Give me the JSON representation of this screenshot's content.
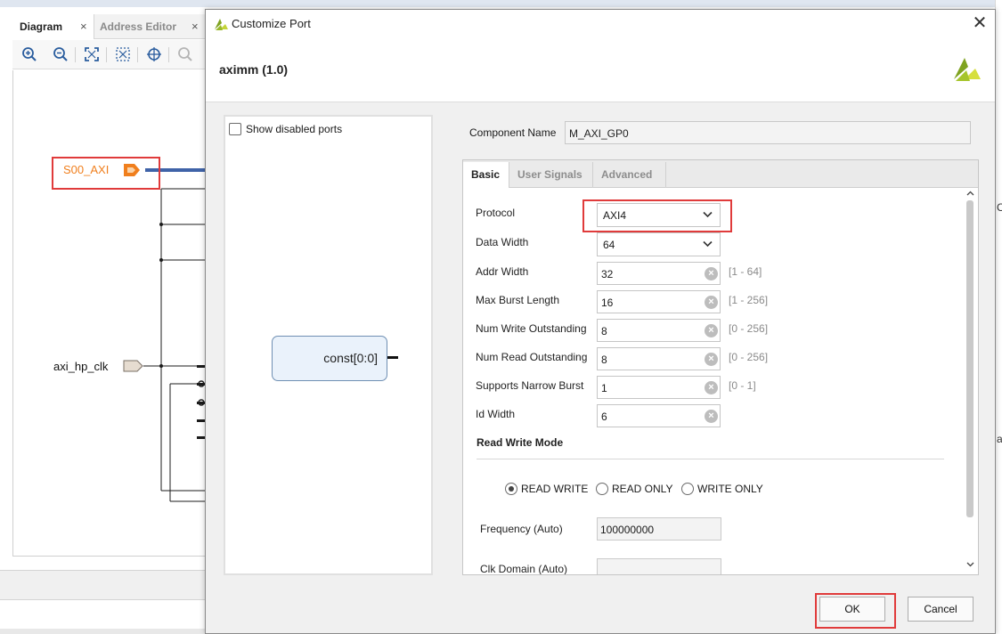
{
  "background": {
    "tabs": [
      {
        "label": "Diagram"
      },
      {
        "label": "Address Editor"
      }
    ],
    "tab_close_glyph": "×",
    "toolbar_icons": [
      "zoom-in-icon",
      "zoom-out-icon",
      "fit-view-icon",
      "fit-selection-icon",
      "crosshair-icon",
      "search-icon"
    ],
    "ports": {
      "s00_axi": "S00_AXI",
      "axi_hp_clk": "axi_hp_clk"
    },
    "colors": {
      "bus": "#3f63a8",
      "port_orange": "#f07f1d",
      "highlight_red": "#e03b3b"
    }
  },
  "dialog": {
    "title": "Customize Port",
    "close_glyph": "✕",
    "ip_name": "aximm (1.0)",
    "show_disabled_ports": "Show disabled ports",
    "symbol_port_label": "const[0:0]",
    "component_name_label": "Component Name",
    "component_name_value": "M_AXI_GP0",
    "tabs": [
      {
        "label": "Basic",
        "active": true
      },
      {
        "label": "User Signals",
        "active": false
      },
      {
        "label": "Advanced",
        "active": false
      }
    ],
    "protocol": {
      "label": "Protocol",
      "value": "AXI4"
    },
    "data_width": {
      "label": "Data Width",
      "value": "64"
    },
    "params": [
      {
        "label": "Addr Width",
        "value": "32",
        "range": "[1 - 64]"
      },
      {
        "label": "Max Burst Length",
        "value": "16",
        "range": "[1 - 256]"
      },
      {
        "label": "Num Write Outstanding",
        "value": "8",
        "range": "[0 - 256]"
      },
      {
        "label": "Num Read Outstanding",
        "value": "8",
        "range": "[0 - 256]"
      },
      {
        "label": "Supports Narrow Burst",
        "value": "1",
        "range": "[0 - 1]"
      },
      {
        "label": "Id Width",
        "value": "6",
        "range": ""
      }
    ],
    "read_write_mode": {
      "title": "Read Write Mode",
      "options": [
        "READ WRITE",
        "READ ONLY",
        "WRITE ONLY"
      ],
      "selected": "READ WRITE"
    },
    "frequency": {
      "label": "Frequency (Auto)",
      "value": "100000000"
    },
    "clk_domain": {
      "label": "Clk Domain (Auto)",
      "value": ""
    },
    "buttons": {
      "ok": "OK",
      "cancel": "Cancel"
    }
  },
  "right_edge_fragments": [
    "C",
    "al"
  ]
}
